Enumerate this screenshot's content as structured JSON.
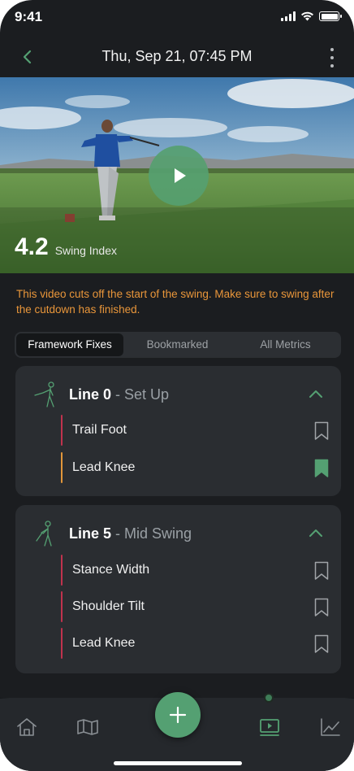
{
  "status_bar": {
    "time": "9:41"
  },
  "header": {
    "title": "Thu, Sep 21, 07:45 PM"
  },
  "video": {
    "swing_index_value": "4.2",
    "swing_index_label": "Swing Index"
  },
  "warning": "This video cuts off the start of the swing.  Make sure to swing after the cutdown has finished.",
  "tabs": [
    {
      "label": "Framework Fixes",
      "active": true
    },
    {
      "label": "Bookmarked",
      "active": false
    },
    {
      "label": "All Metrics",
      "active": false
    }
  ],
  "cards": [
    {
      "line": "Line 0",
      "phase": "- Set Up",
      "fixes": [
        {
          "label": "Trail Foot",
          "bar_color": "#c0334d",
          "bookmarked": false
        },
        {
          "label": "Lead Knee",
          "bar_color": "#e2963a",
          "bookmarked": true
        }
      ]
    },
    {
      "line": "Line 5",
      "phase": "- Mid Swing",
      "fixes": [
        {
          "label": "Stance Width",
          "bar_color": "#c0334d",
          "bookmarked": false
        },
        {
          "label": "Shoulder Tilt",
          "bar_color": "#c0334d",
          "bookmarked": false
        },
        {
          "label": "Lead Knee",
          "bar_color": "#c0334d",
          "bookmarked": false
        }
      ]
    }
  ],
  "bottom_nav": {
    "items": [
      "home-icon",
      "map-icon",
      "add-icon",
      "video-icon",
      "chart-icon"
    ],
    "active": "video-icon"
  },
  "colors": {
    "accent": "#54a072",
    "background": "#1b1d20",
    "card": "#2a2d31",
    "warning": "#e9963a",
    "bookmark_active": "#54a072"
  }
}
